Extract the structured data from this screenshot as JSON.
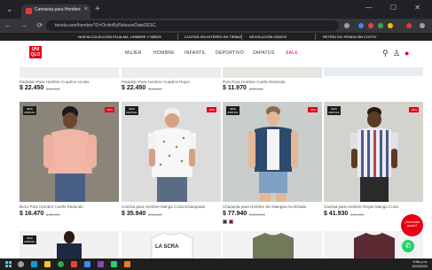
{
  "browser": {
    "tab_title": "Camiseta para Hombre Con gen...",
    "tab_close": "×",
    "new_tab": "+",
    "back": "⌄",
    "window_controls": "—  ☐  ✕",
    "nav_buttons": "← → ⟳ ⌂",
    "url": "tienda.com/hombre?O=OrderByReleaseDateDESC",
    "accent": "#e53935"
  },
  "promo_bar": {
    "items": [
      "NUEVA COLECCIÓN EN ALMA, HOMBRE Y NIÑOS",
      "CUOTAS SIN INTERÉS EN TIENDA",
      "DEVOLUCIÓN GRATIS",
      "RETIRO EN TIENDA SIN COSTO"
    ]
  },
  "header": {
    "logo": "UNI QLO",
    "nav": [
      "MUJER",
      "HOMBRE",
      "INFANTIL",
      "DEPORTIVO",
      "ZAPATOS",
      "SALE"
    ],
    "icons": [
      "search-icon",
      "user-icon",
      "bag-icon"
    ],
    "brand_color": "#e60012"
  },
  "products_top": [
    {
      "name": "Pantalón Para Hombre Cuadros Azules",
      "price": "$ 22.450",
      "old": "$ 44.900"
    },
    {
      "name": "Pantalón Para Hombre Cuadros Rojos",
      "price": "$ 22.450",
      "old": "$ 44.900"
    },
    {
      "name": "Polo Para Hombre Cuello Redondo",
      "price": "$ 11.970",
      "old": "$ 23.940"
    },
    {
      "name": "",
      "price": "",
      "old": ""
    }
  ],
  "products_main": [
    {
      "name": "Buzo Para Hombre Cuello Redondo",
      "price": "$ 16.470",
      "old": "$ 32.940",
      "badge_new": "NEW ARRIVAL",
      "badge_sale": "-50%"
    },
    {
      "name": "Camisa para Hombre Manga Corta Estampada",
      "price": "$ 35.940",
      "old": "$ 59.900",
      "badge_new": "NEW ARRIVAL",
      "badge_sale": "-40%"
    },
    {
      "name": "Chaqueta para Hombre Sin Mangas Acolchada",
      "price": "$ 77.940",
      "old": "$ 129.900",
      "badge_new": "NEW ARRIVAL",
      "badge_sale": "-40%"
    },
    {
      "name": "Camisa para Hombre Rayas Manga Corta",
      "price": "$ 41.930",
      "old": "$ 59.900",
      "badge_new": "NEW ARRIVAL",
      "badge_sale": "-30%"
    }
  ],
  "products_bottom": [
    {
      "badge_new": "NEW ARRIVAL"
    },
    {
      "print": "LA SCRA"
    },
    {},
    {}
  ],
  "chat": {
    "label": "¿Necesitas ayuda?"
  },
  "whatsapp_icon": "✆",
  "taskbar": {
    "time": "9:56 p.m.",
    "date": "10/4/2024"
  }
}
